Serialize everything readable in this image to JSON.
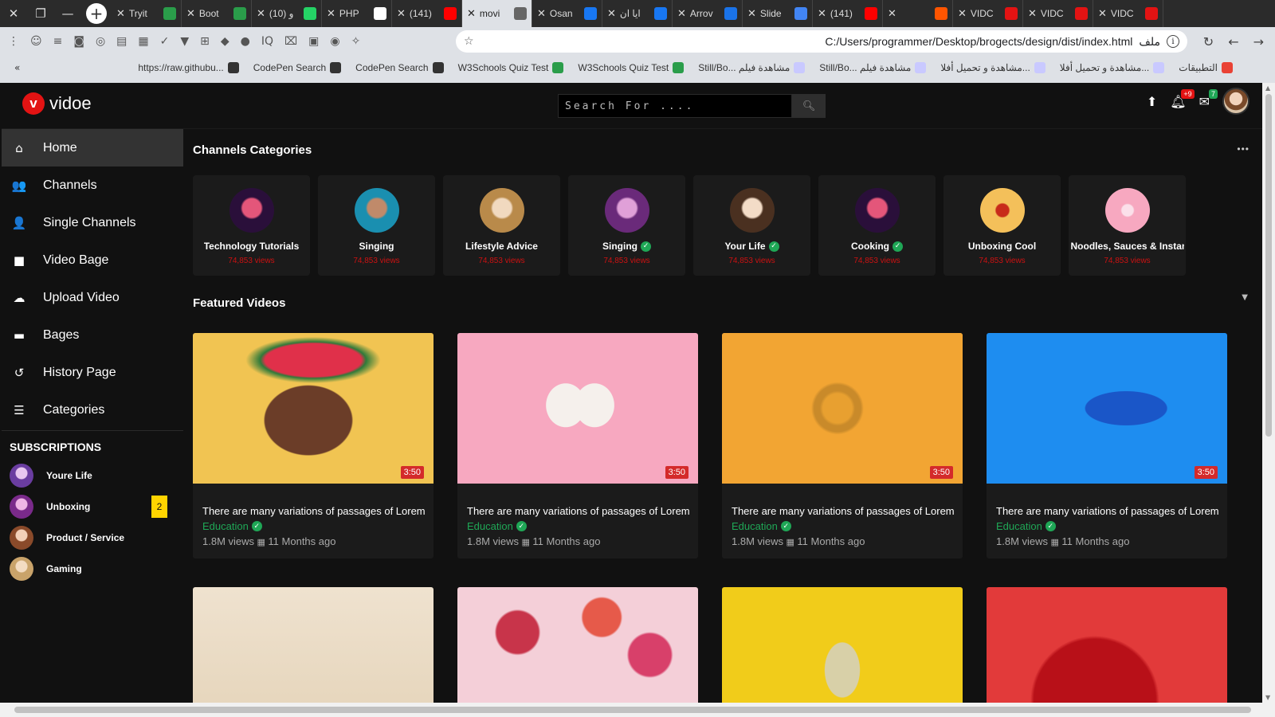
{
  "browser": {
    "tabs": [
      {
        "title": "Tryit",
        "fav": "#2a9d4a"
      },
      {
        "title": "Boot",
        "fav": "#2a9d4a"
      },
      {
        "title": "(10) ‎و",
        "fav": "#25d366"
      },
      {
        "title": "PHP",
        "fav": "#ffffff"
      },
      {
        "title": "(141)",
        "fav": "#ff0000"
      },
      {
        "title": "movi",
        "fav": "#666666"
      },
      {
        "title": "Osan",
        "fav": "#1877f2"
      },
      {
        "title": "ايا ان",
        "fav": "#1877f2"
      },
      {
        "title": "Arrov",
        "fav": "#1a73e8"
      },
      {
        "title": "Slide",
        "fav": "#4285f4"
      },
      {
        "title": "(141)",
        "fav": "#ff0000"
      },
      {
        "title": "",
        "fav": "#ff5500"
      },
      {
        "title": "VIDC",
        "fav": "#e31313"
      },
      {
        "title": "VIDC",
        "fav": "#e31313"
      },
      {
        "title": "VIDC",
        "fav": "#e31313"
      }
    ],
    "url": "C:/Users/programmer/Desktop/brogects/design/dist/index.html",
    "url_prefix": "ملف",
    "bookmarks": [
      {
        "label": "https://raw.githubu...",
        "fav": "#333333"
      },
      {
        "label": "CodePen Search",
        "fav": "#333333"
      },
      {
        "label": "CodePen Search",
        "fav": "#333333"
      },
      {
        "label": "W3Schools Quiz Test",
        "fav": "#2a9d4a"
      },
      {
        "label": "W3Schools Quiz Test",
        "fav": "#2a9d4a"
      },
      {
        "label": "Still/Bo... مشاهدة فيلم",
        "fav": "#c9c9ff"
      },
      {
        "label": "Still/Bo... مشاهدة فيلم",
        "fav": "#c9c9ff"
      },
      {
        "label": "مشاهدة و تحميل أفلا...",
        "fav": "#c9c9ff"
      },
      {
        "label": "مشاهدة و تحميل أفلا...",
        "fav": "#c9c9ff"
      },
      {
        "label": "التطبيقات",
        "fav": "#e94235"
      }
    ]
  },
  "site": {
    "logo_mark": "v",
    "logo_text": "vidoe",
    "search_placeholder": "Search For ....",
    "notif_badge": "+9",
    "msg_badge": "7",
    "accent": "#e31313"
  },
  "sidebar": {
    "items": [
      {
        "label": "Home",
        "icon": "home-icon",
        "glyph": "⌂"
      },
      {
        "label": "Channels",
        "icon": "users-icon",
        "glyph": "👥"
      },
      {
        "label": "Single Channels",
        "icon": "user-icon",
        "glyph": "👤"
      },
      {
        "label": "Video Bage",
        "icon": "video-camera-icon",
        "glyph": "■"
      },
      {
        "label": "Upload Video",
        "icon": "cloud-upload-icon",
        "glyph": "☁"
      },
      {
        "label": "Bages",
        "icon": "folder-icon",
        "glyph": "▬"
      },
      {
        "label": "History Page",
        "icon": "history-icon",
        "glyph": "↺"
      },
      {
        "label": "Categories",
        "icon": "list-icon",
        "glyph": "☰"
      }
    ],
    "subscriptions_title": "SUBSCRIPTIONS",
    "subscriptions": [
      {
        "label": "Youre Life",
        "badge": ""
      },
      {
        "label": "Unboxing",
        "badge": "2"
      },
      {
        "label": "Product / Service",
        "badge": ""
      },
      {
        "label": "Gaming",
        "badge": ""
      }
    ]
  },
  "main": {
    "categories_title": "Channels Categories",
    "featured_title": "Featured Videos",
    "categories": [
      {
        "name": "Technology Tutorials",
        "views": "74,853 views",
        "verified": false
      },
      {
        "name": "Singing",
        "views": "74,853 views",
        "verified": false
      },
      {
        "name": "Lifestyle Advice",
        "views": "74,853 views",
        "verified": false
      },
      {
        "name": "Singing",
        "views": "74,853 views",
        "verified": true
      },
      {
        "name": "Your Life",
        "views": "74,853 views",
        "verified": true
      },
      {
        "name": "Cooking",
        "views": "74,853 views",
        "verified": true
      },
      {
        "name": "Unboxing Cool",
        "views": "74,853 views",
        "verified": false
      },
      {
        "name": "Noodles, Sauces & Instant Food",
        "views": "74,853 views",
        "verified": false
      }
    ],
    "videos": [
      {
        "title": "There are many variations of passages of Lorem",
        "category": "Education",
        "views": "1.8M views",
        "age": "11 Months ago",
        "duration": "3:50"
      },
      {
        "title": "There are many variations of passages of Lorem",
        "category": "Education",
        "views": "1.8M views",
        "age": "11 Months ago",
        "duration": "3:50"
      },
      {
        "title": "There are many variations of passages of Lorem",
        "category": "Education",
        "views": "1.8M views",
        "age": "11 Months ago",
        "duration": "3:50"
      },
      {
        "title": "There are many variations of passages of Lorem",
        "category": "Education",
        "views": "1.8M views",
        "age": "11 Months ago",
        "duration": "3:50"
      },
      {
        "title": "",
        "category": "",
        "views": "",
        "age": "",
        "duration": ""
      },
      {
        "title": "",
        "category": "",
        "views": "",
        "age": "",
        "duration": ""
      },
      {
        "title": "",
        "category": "",
        "views": "",
        "age": "",
        "duration": ""
      },
      {
        "title": "",
        "category": "",
        "views": "",
        "age": "",
        "duration": ""
      }
    ]
  }
}
